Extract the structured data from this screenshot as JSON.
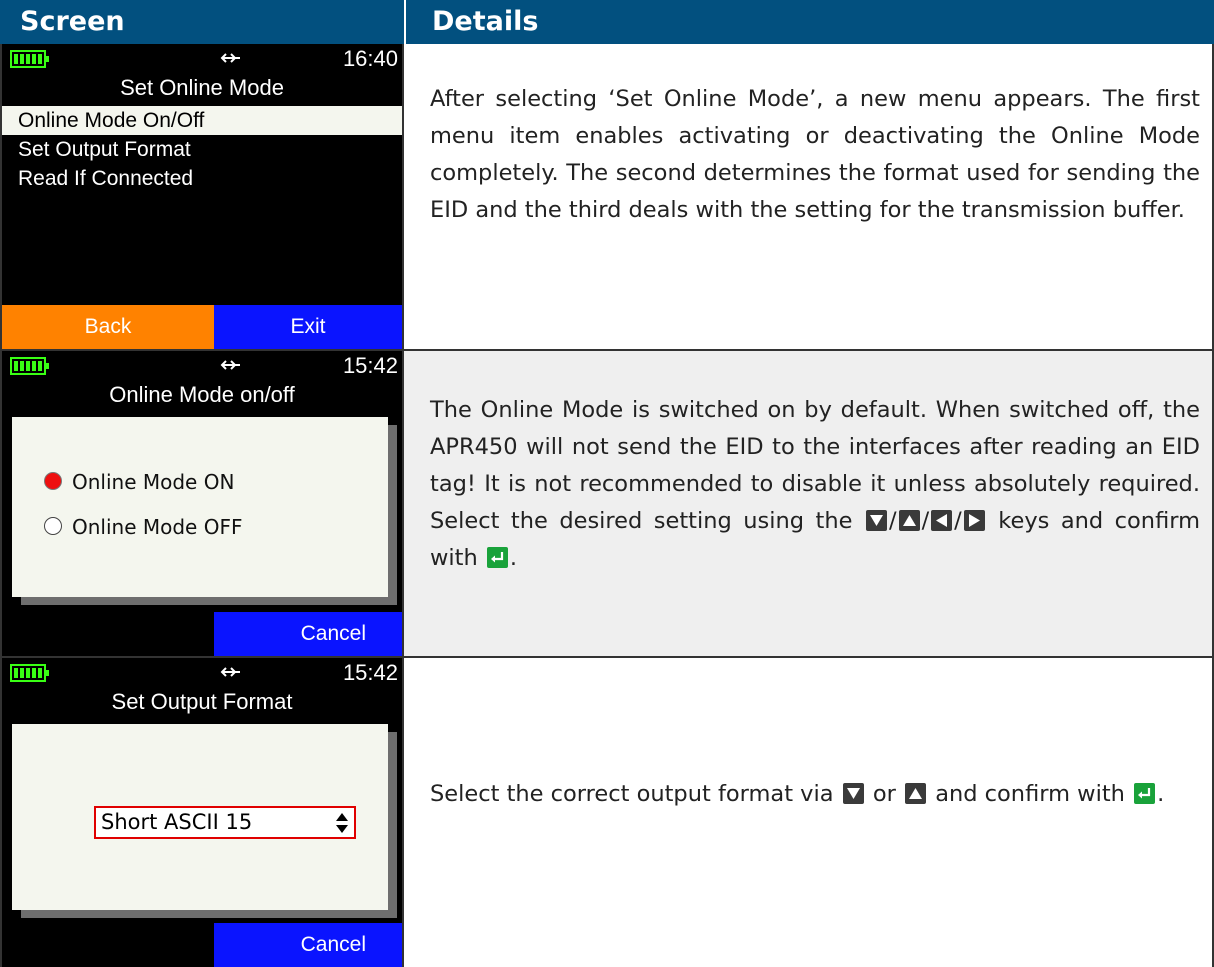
{
  "header": {
    "col_screen": "Screen",
    "col_details": "Details"
  },
  "colors": {
    "header_bg": "#02507f",
    "battery": "#39ff14",
    "back_key": "#ff8200",
    "blue_key": "#0a14ff",
    "enter_key": "#19a23a"
  },
  "rows": [
    {
      "screen": {
        "time": "16:40",
        "title": "Set Online Mode",
        "menu": [
          "Online Mode On/Off",
          "Set Output Format",
          "Read If Connected"
        ],
        "back": "Back",
        "exit": "Exit"
      },
      "details": "After selecting ‘Set Online Mode’, a new menu appears. The first menu item enables activating or deactivating the Online Mode completely. The second determines the format used for sending the EID and the third deals with the setting for the transmission buffer."
    },
    {
      "screen": {
        "time": "15:42",
        "title": "Online Mode on/off",
        "option_on": "Online Mode ON",
        "option_off": "Online Mode OFF",
        "cancel": "Cancel"
      },
      "details_a": "The Online Mode is switched on by default. When switched off, the APR450 will not send the EID to the interfaces after reading an EID tag! It is not recommended to disable it unless absolutely required. Select the desired setting using the",
      "sep": "/",
      "details_b": "keys and confirm with",
      "details_end": "."
    },
    {
      "screen": {
        "time": "15:42",
        "title": "Set Output Format",
        "selected_format": "Short ASCII 15",
        "cancel": "Cancel"
      },
      "details_a": "Select the correct output format via",
      "or": "or",
      "details_b": "and confirm with",
      "details_end": "."
    }
  ],
  "icons": [
    "battery-icon",
    "usb-icon",
    "down-key-icon",
    "up-key-icon",
    "left-key-icon",
    "right-key-icon",
    "enter-key-icon",
    "spin-arrows-icon"
  ]
}
